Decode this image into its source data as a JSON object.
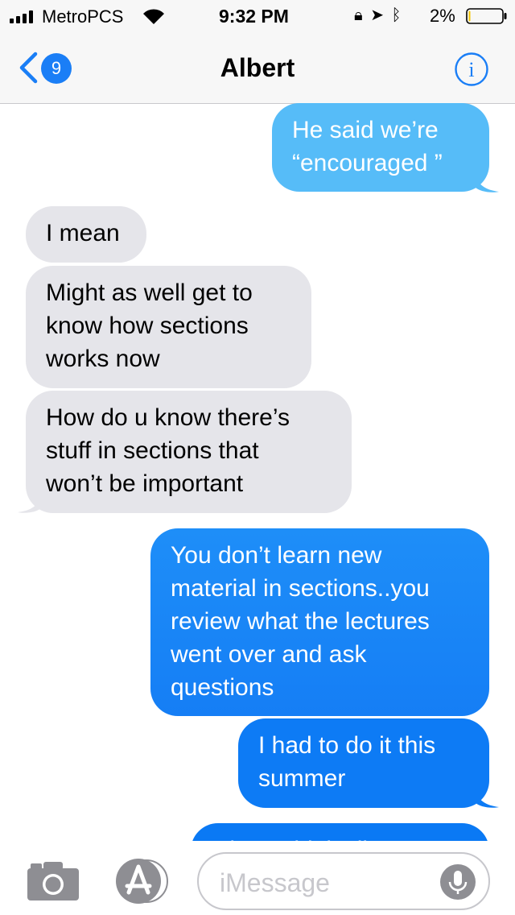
{
  "status_bar": {
    "carrier": "MetroPCS",
    "time": "9:32 PM",
    "battery_percent": "2%",
    "battery_level": 0.02,
    "icons": [
      "signal-icon",
      "wifi-icon",
      "orientation-lock-icon",
      "location-icon",
      "bluetooth-icon",
      "battery-icon"
    ]
  },
  "nav": {
    "back_count": "9",
    "contact_name": "Albert",
    "info_icon": "info-icon"
  },
  "messages": [
    {
      "direction": "outgoing",
      "text": "He said we’re\n“encouraged ”",
      "color": "#56bcf8"
    },
    {
      "direction": "incoming",
      "text": "I mean"
    },
    {
      "direction": "incoming",
      "text": "Might as well get to\nknow how sections\nworks now"
    },
    {
      "direction": "incoming",
      "text": "How do u know there’s\nstuff in sections that\nwon’t be important"
    },
    {
      "direction": "outgoing",
      "text": "You don’t learn new\nmaterial in sections..you\nreview what the lectures\nwent over and ask\nquestions",
      "color": "#1a83f5"
    },
    {
      "direction": "outgoing",
      "text": "I had to do it this\nsummer",
      "color": "#0d7bf5"
    },
    {
      "direction": "outgoing",
      "text": "Okay I think I’ll go to",
      "color": "#0a79f4"
    }
  ],
  "compose": {
    "placeholder": "iMessage",
    "camera_icon": "camera-icon",
    "apps_icon": "app-store-icon",
    "mic_icon": "microphone-icon"
  },
  "colors": {
    "accent": "#1a7ef6",
    "incoming_bubble": "#e5e5ea",
    "bar_background": "#f7f7f7"
  }
}
